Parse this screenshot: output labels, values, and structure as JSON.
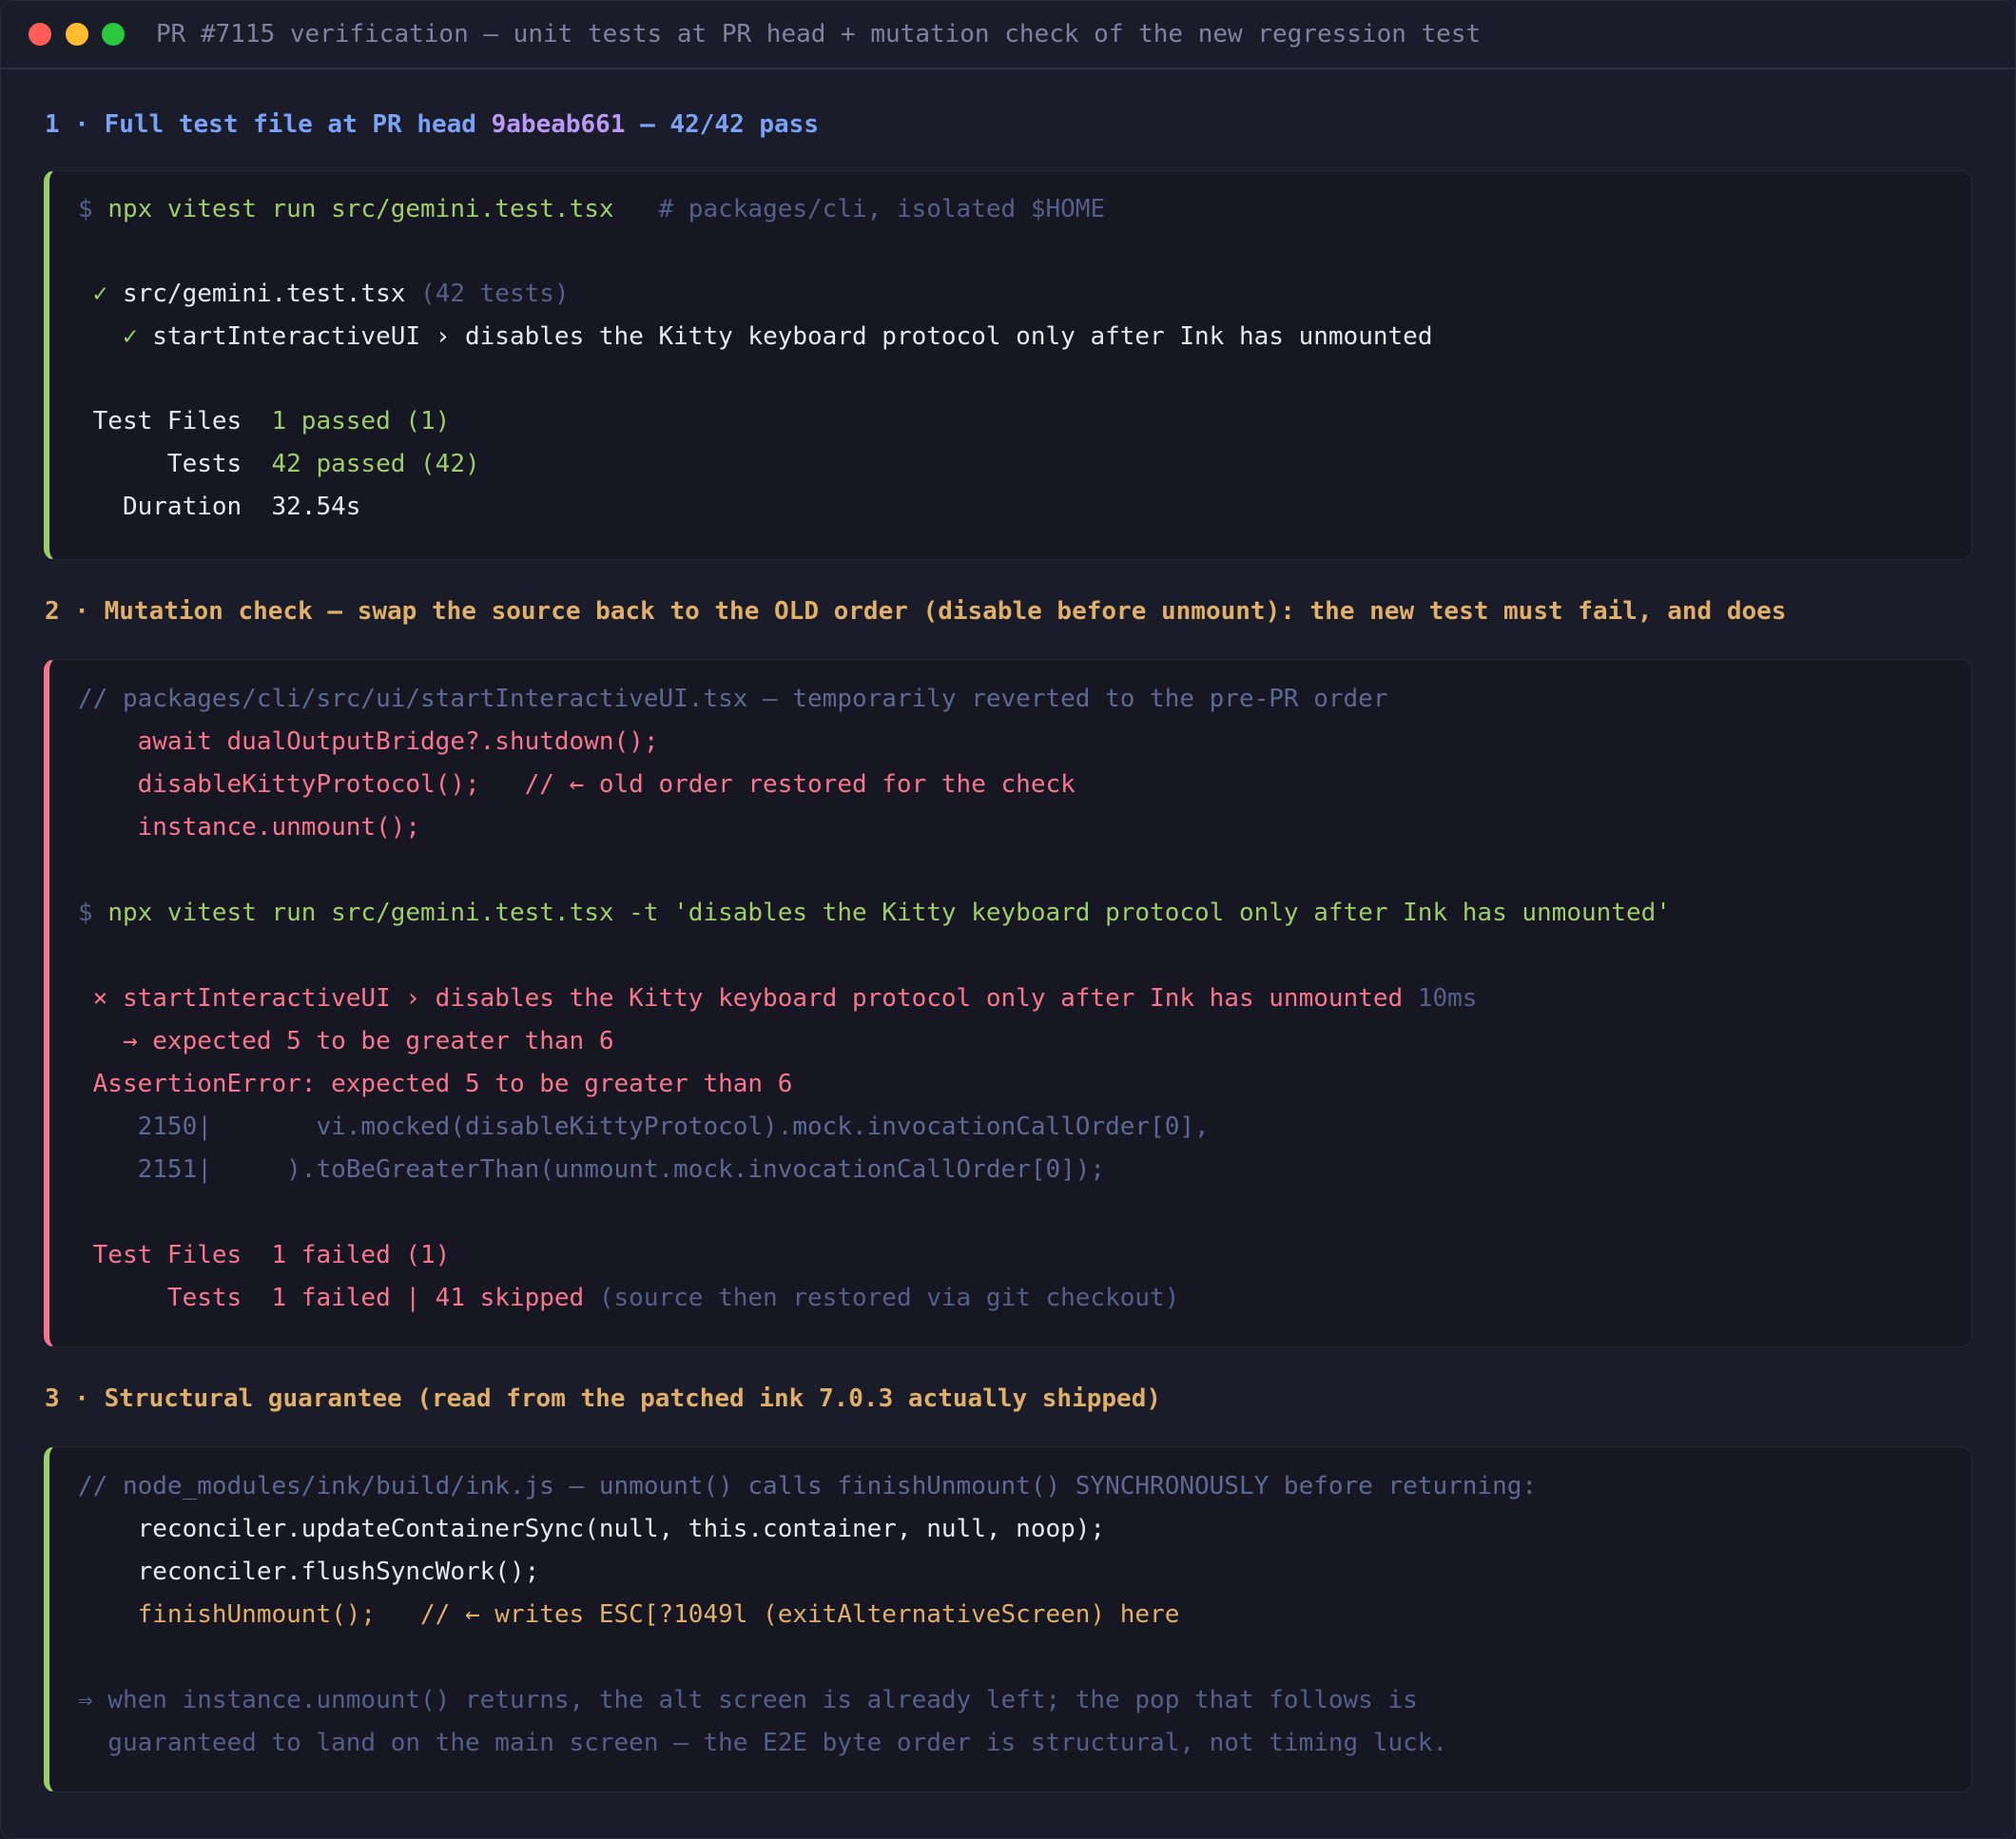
{
  "window": {
    "title": "PR #7115 verification — unit tests at PR head + mutation check of the new regression test"
  },
  "section1": {
    "heading_prefix": "1 · Full test file at PR head ",
    "heading_commit": "9abeab661",
    "heading_suffix": " — 42/42 pass",
    "command_prompt": "$ ",
    "command": "npx vitest run src/gemini.test.tsx",
    "command_comment": "   # packages/cli, isolated $HOME",
    "file_check": " ✓ ",
    "file_name": "src/gemini.test.tsx",
    "file_count": " (42 tests)",
    "test_check": "   ✓ ",
    "test_name": "startInteractiveUI › disables the Kitty keyboard protocol only after Ink has unmounted",
    "summary_files_label": " Test Files  ",
    "summary_files_value": "1 passed (1)",
    "summary_tests_label": "      Tests  ",
    "summary_tests_value": "42 passed (42)",
    "summary_duration_label": "   Duration  ",
    "summary_duration_value": "32.54s"
  },
  "section2": {
    "heading": "2 · Mutation check — swap the source back to the OLD order (disable before unmount): the new test must fail, and does",
    "comment": "// packages/cli/src/ui/startInteractiveUI.tsx — temporarily reverted to the pre-PR order",
    "code_line1": "    await dualOutputBridge?.shutdown();",
    "code_line2": "    disableKittyProtocol();   // ← old order restored for the check",
    "code_line3": "    instance.unmount();",
    "command_prompt": "$ ",
    "command": "npx vitest run src/gemini.test.tsx -t 'disables the Kitty keyboard protocol only after Ink has unmounted'",
    "fail_line": " × startInteractiveUI › disables the Kitty keyboard protocol only after Ink has unmounted",
    "fail_time": " 10ms",
    "arrow_line": "   → expected 5 to be greater than 6",
    "assertion_line": " AssertionError: expected 5 to be greater than 6",
    "stack_line1": "    2150|       vi.mocked(disableKittyProtocol).mock.invocationCallOrder[0],",
    "stack_line2": "    2151|     ).toBeGreaterThan(unmount.mock.invocationCallOrder[0]);",
    "summary_files": " Test Files  1 failed (1)",
    "summary_tests": "      Tests  1 failed | 41 skipped",
    "summary_note": " (source then restored via git checkout)"
  },
  "section3": {
    "heading": "3 · Structural guarantee (read from the patched ink 7.0.3 actually shipped)",
    "comment": "// node_modules/ink/build/ink.js — unmount() calls finishUnmount() SYNCHRONOUSLY before returning:",
    "code_line1": "    reconciler.updateContainerSync(null, this.container, null, noop);",
    "code_line2": "    reconciler.flushSyncWork();",
    "code_line3": "    finishUnmount();   // ← writes ESC[?1049l (exitAlternativeScreen) here",
    "note_line1": "⇒ when instance.unmount() returns, the alt screen is already left; the pop that follows is",
    "note_line2": "  guaranteed to land on the main screen — the E2E byte order is structural, not timing luck."
  }
}
